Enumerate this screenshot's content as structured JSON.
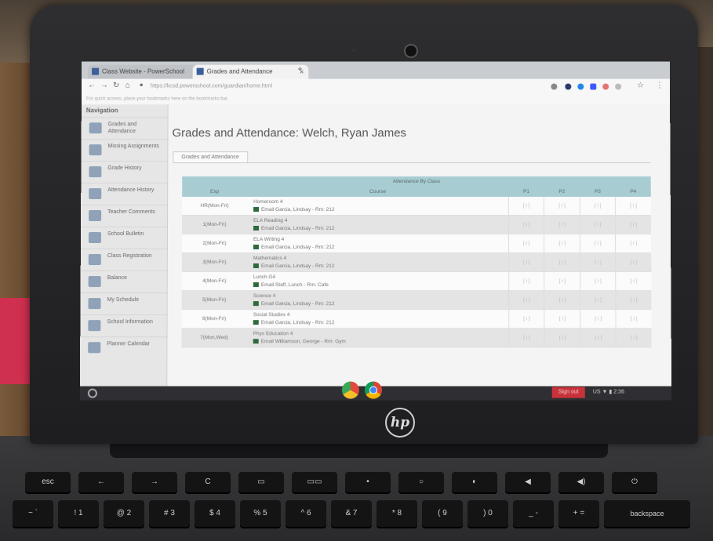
{
  "browser": {
    "tabs": [
      {
        "label": "Class Website - PowerSchool"
      },
      {
        "label": "Grades and Attendance"
      }
    ],
    "url": "https://kcsd.powerschool.com/guardian/home.html",
    "bookmarks_bar": "For quick access, place your bookmarks here on the bookmarks bar."
  },
  "sidebar": {
    "heading": "Navigation",
    "items": [
      {
        "label": "Grades and Attendance",
        "icon": "grades-icon"
      },
      {
        "label": "Missing Assignments",
        "icon": "missing-icon"
      },
      {
        "label": "Grade History",
        "icon": "history-icon"
      },
      {
        "label": "Attendance History",
        "icon": "attendance-icon"
      },
      {
        "label": "Teacher Comments",
        "icon": "comments-icon"
      },
      {
        "label": "School Bulletin",
        "icon": "bulletin-icon"
      },
      {
        "label": "Class Registration",
        "icon": "registration-icon"
      },
      {
        "label": "Balance",
        "icon": "balance-icon"
      },
      {
        "label": "My Schedule",
        "icon": "schedule-icon"
      },
      {
        "label": "School Information",
        "icon": "school-icon"
      },
      {
        "label": "Planner Calendar",
        "icon": "calendar-icon"
      }
    ]
  },
  "main": {
    "title": "Grades and Attendance: Welch, Ryan James",
    "active_tab": "Grades and Attendance",
    "table": {
      "caption": "Attendance By Class",
      "col_exp": "Exp",
      "col_course": "Course",
      "terms": [
        "P1",
        "P2",
        "P3",
        "P4"
      ],
      "rows": [
        {
          "exp": "HR(Mon-Fri)",
          "course": "Homeroom 4",
          "teacher": "Email Garcia, Lindsay - Rm: 212",
          "cells": [
            "[ i ]",
            "[ i ]",
            "[ i ]",
            "[ i ]"
          ]
        },
        {
          "exp": "1(Mon-Fri)",
          "course": "ELA Reading 4",
          "teacher": "Email Garcia, Lindsay - Rm: 212",
          "cells": [
            "[ i ]",
            "[ i ]",
            "[ i ]",
            "[ i ]"
          ]
        },
        {
          "exp": "2(Mon-Fri)",
          "course": "ELA Writing 4",
          "teacher": "Email Garcia, Lindsay - Rm: 212",
          "cells": [
            "[ i ]",
            "[ i ]",
            "[ i ]",
            "[ i ]"
          ]
        },
        {
          "exp": "3(Mon-Fri)",
          "course": "Mathematics 4",
          "teacher": "Email Garcia, Lindsay - Rm: 212",
          "cells": [
            "[ i ]",
            "[ i ]",
            "[ i ]",
            "[ i ]"
          ]
        },
        {
          "exp": "4(Mon-Fri)",
          "course": "Lunch G4",
          "teacher": "Email Staff, Lunch - Rm: Cafe",
          "cells": [
            "[ i ]",
            "[ i ]",
            "[ i ]",
            "[ i ]"
          ]
        },
        {
          "exp": "5(Mon-Fri)",
          "course": "Science 4",
          "teacher": "Email Garcia, Lindsay - Rm: 212",
          "cells": [
            "[ i ]",
            "[ i ]",
            "[ i ]",
            "[ i ]"
          ]
        },
        {
          "exp": "6(Mon-Fri)",
          "course": "Social Studies 4",
          "teacher": "Email Garcia, Lindsay - Rm: 212",
          "cells": [
            "[ i ]",
            "[ i ]",
            "[ i ]",
            "[ i ]"
          ]
        },
        {
          "exp": "7(Mon,Wed)",
          "course": "Phys Education 4",
          "teacher": "Email Williamson, George - Rm: Gym",
          "cells": [
            "[ i ]",
            "[ i ]",
            "[ i ]",
            "[ i ]"
          ]
        }
      ]
    }
  },
  "shelf": {
    "signout": "Sign out",
    "status": "US ▼ ▮ 2:36"
  },
  "laptop": {
    "brand": "hp"
  },
  "keyboard": {
    "row1": [
      "esc",
      "←",
      "→",
      "C",
      "▭",
      "▭▭",
      "•",
      "○",
      "◐",
      "◀",
      "◀)",
      "⏻"
    ],
    "row2": [
      "~ `",
      "! 1",
      "@ 2",
      "# 3",
      "$ 4",
      "% 5",
      "^ 6",
      "& 7",
      "* 8",
      "( 9",
      ") 0",
      "_ -",
      "+ =",
      "backspace"
    ]
  }
}
